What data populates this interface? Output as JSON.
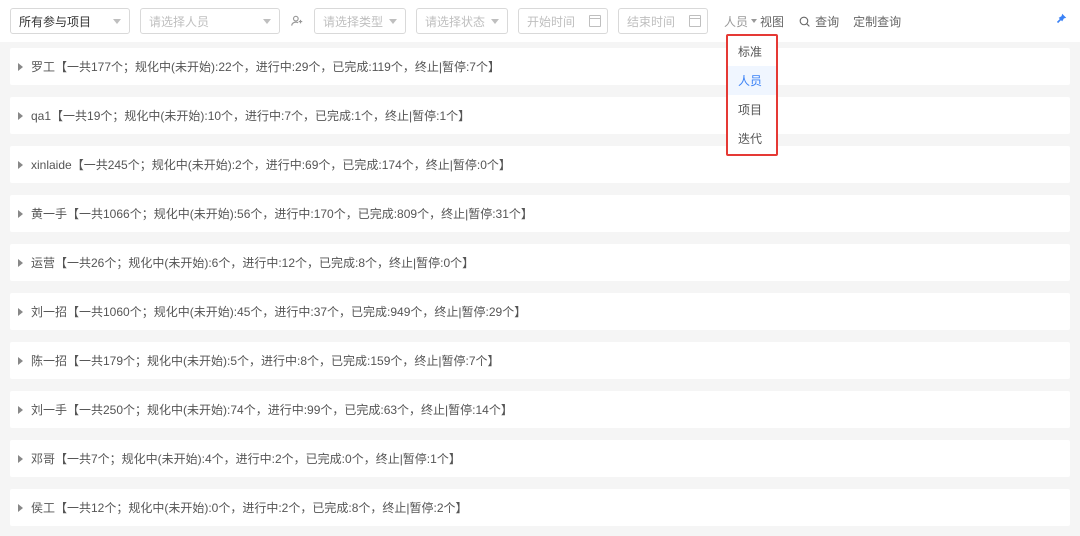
{
  "toolbar": {
    "project_select": {
      "value": "所有参与项目"
    },
    "person_select": {
      "placeholder": "请选择人员"
    },
    "type_select": {
      "placeholder": "请选择类型"
    },
    "status_select": {
      "placeholder": "请选择状态"
    },
    "start_date": {
      "placeholder": "开始时间"
    },
    "end_date": {
      "placeholder": "结束时间"
    },
    "view_label_prefix": "人员",
    "view_label_suffix": "视图",
    "query_label": "查询",
    "custom_query_label": "定制查询"
  },
  "dropdown": {
    "items": [
      "标准",
      "人员",
      "项目",
      "迭代"
    ],
    "active_index": 1
  },
  "rows": [
    {
      "text": "罗工【一共177个；规化中(未开始):22个，进行中:29个，已完成:119个，终止|暂停:7个】"
    },
    {
      "text": "qa1【一共19个；规化中(未开始):10个，进行中:7个，已完成:1个，终止|暂停:1个】"
    },
    {
      "text": "xinlaide【一共245个；规化中(未开始):2个，进行中:69个，已完成:174个，终止|暂停:0个】"
    },
    {
      "text": "黄一手【一共1066个；规化中(未开始):56个，进行中:170个，已完成:809个，终止|暂停:31个】"
    },
    {
      "text": "运营【一共26个；规化中(未开始):6个，进行中:12个，已完成:8个，终止|暂停:0个】"
    },
    {
      "text": "刘一招【一共1060个；规化中(未开始):45个，进行中:37个，已完成:949个，终止|暂停:29个】"
    },
    {
      "text": "陈一招【一共179个；规化中(未开始):5个，进行中:8个，已完成:159个，终止|暂停:7个】"
    },
    {
      "text": "刘一手【一共250个；规化中(未开始):74个，进行中:99个，已完成:63个，终止|暂停:14个】"
    },
    {
      "text": "邓哥【一共7个；规化中(未开始):4个，进行中:2个，已完成:0个，终止|暂停:1个】"
    },
    {
      "text": "侯工【一共12个；规化中(未开始):0个，进行中:2个，已完成:8个，终止|暂停:2个】"
    }
  ]
}
